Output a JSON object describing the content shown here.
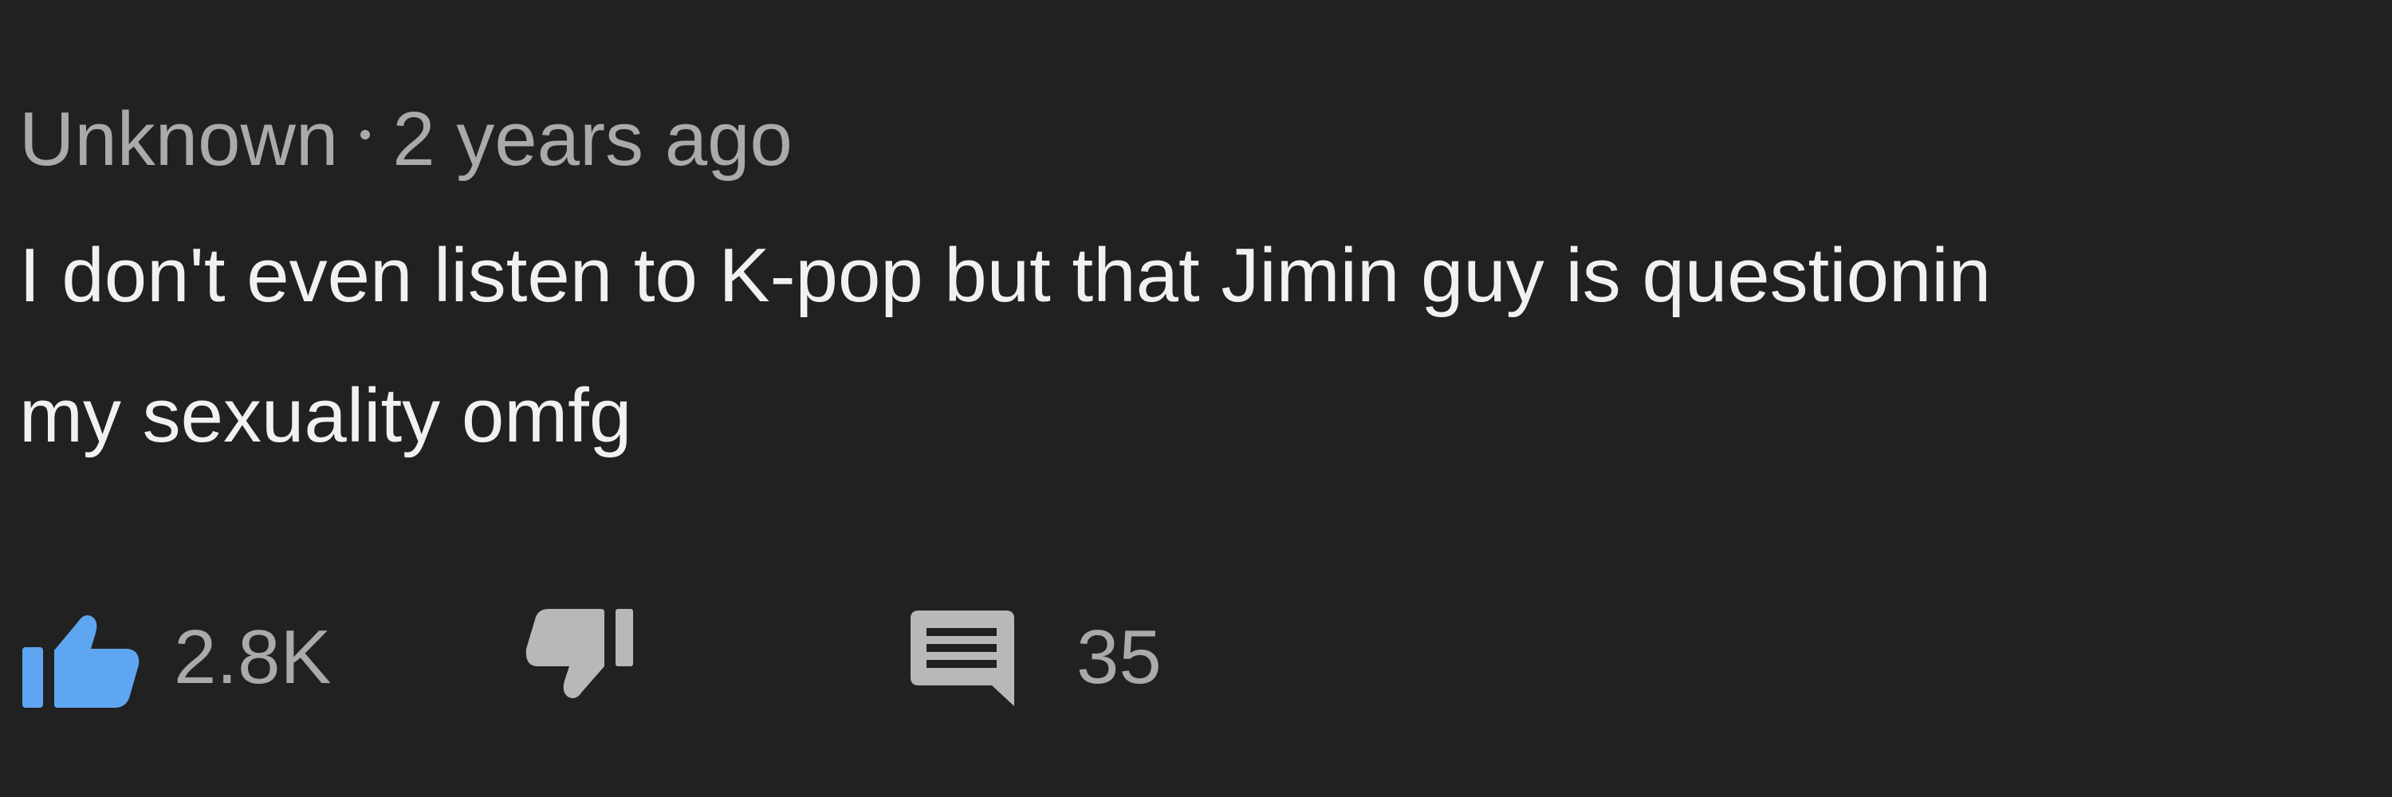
{
  "comment": {
    "author": "Unknown",
    "separator": "•",
    "timestamp": "2 years ago",
    "text_lines": [
      "I don't even listen to K-pop but that Jimin guy is questionin",
      "my sexuality omfg"
    ]
  },
  "actions": {
    "like": {
      "icon": "thumbs-up-icon",
      "count": "2.8K",
      "active": true
    },
    "dislike": {
      "icon": "thumbs-down-icon"
    },
    "reply": {
      "icon": "comment-icon",
      "count": "35"
    }
  },
  "colors": {
    "background": "#212121",
    "meta_text": "#aaaaaa",
    "body_text": "#f1f1f1",
    "like_active": "#5ea6f2",
    "icon_gray": "#b8b8b8"
  }
}
